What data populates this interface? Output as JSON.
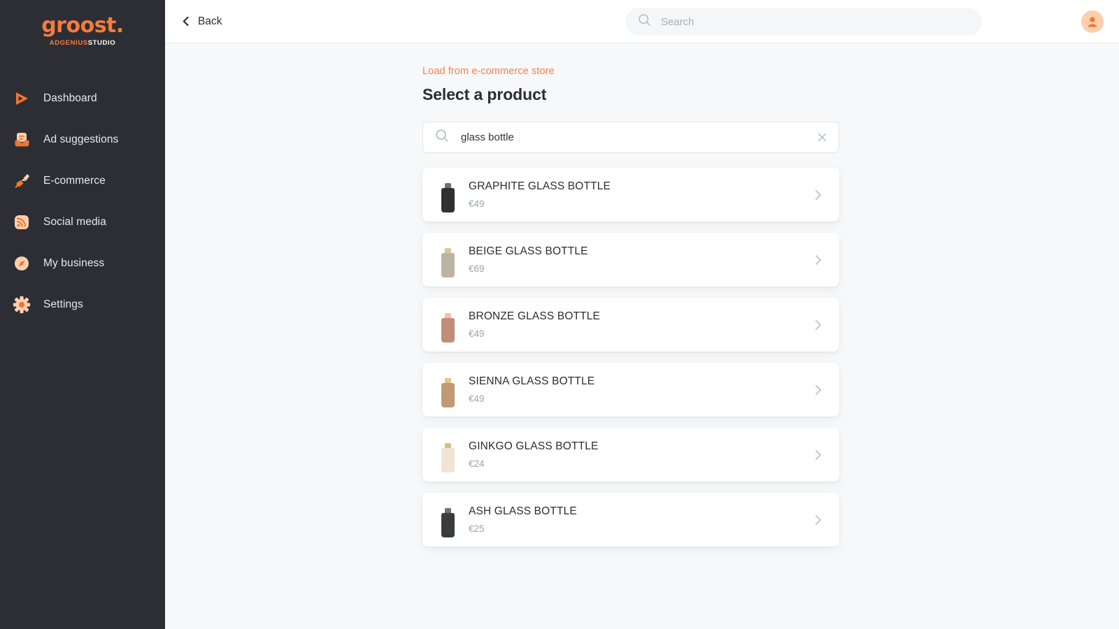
{
  "sidebar": {
    "logo": {
      "mark": "groost.",
      "sub_accent": "ADGENIUS",
      "sub_plain": "STUDIO"
    },
    "items": [
      {
        "label": "Dashboard",
        "icon": "play-icon"
      },
      {
        "label": "Ad suggestions",
        "icon": "inbox-icon"
      },
      {
        "label": "E-commerce",
        "icon": "plug-icon"
      },
      {
        "label": "Social media",
        "icon": "rss-icon"
      },
      {
        "label": "My business",
        "icon": "compass-icon"
      },
      {
        "label": "Settings",
        "icon": "gear-icon"
      }
    ]
  },
  "topbar": {
    "back_label": "Back",
    "search_placeholder": "Search",
    "search_value": "",
    "avatar_alt": "account-avatar"
  },
  "content": {
    "eyebrow": "Load from e-commerce store",
    "title": "Select a product",
    "search_value": "glass bottle",
    "search_placeholder": "Search products",
    "products": [
      {
        "name": "GRAPHITE GLASS BOTTLE",
        "price": "€49",
        "body_color": "#2e3034",
        "cap_color": "#6c7076"
      },
      {
        "name": "BEIGE GLASS BOTTLE",
        "price": "€69",
        "body_color": "#bdb3a3",
        "cap_color": "#d8c79b"
      },
      {
        "name": "BRONZE GLASS BOTTLE",
        "price": "€49",
        "body_color": "#c08d77",
        "cap_color": "#e8c3ad"
      },
      {
        "name": "SIENNA GLASS BOTTLE",
        "price": "€49",
        "body_color": "#c19a74",
        "cap_color": "#e2c392"
      },
      {
        "name": "GINKGO GLASS BOTTLE",
        "price": "€24",
        "body_color": "#f0e4d3",
        "cap_color": "#d9bd82"
      },
      {
        "name": "ASH GLASS BOTTLE",
        "price": "€25",
        "body_color": "#3a3c3e",
        "cap_color": "#6f7376"
      }
    ]
  },
  "colors": {
    "accent": "#f47b3f",
    "sidebar_bg": "#2c2e34",
    "page_bg": "#f7f8fa",
    "card_bg": "#ffffff",
    "muted_text": "#9ea3ad"
  }
}
